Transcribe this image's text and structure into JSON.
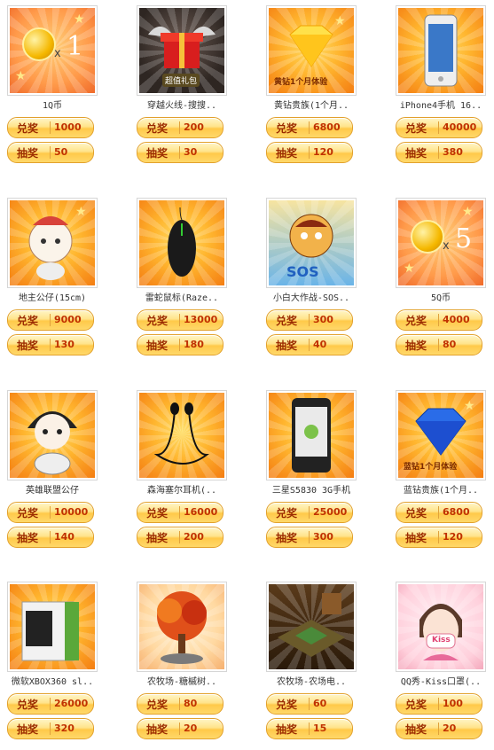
{
  "labels": {
    "exchange": "兑奖",
    "draw": "抽奖"
  },
  "items": [
    {
      "name": "1Q币",
      "exchange": "1000",
      "draw": "50",
      "icon": "qcoin-1-icon",
      "mult": "x",
      "count": "1"
    },
    {
      "name": "穿越火线-搜搜..",
      "exchange": "200",
      "draw": "30",
      "icon": "gift-box-icon",
      "art_text": "超值礼包"
    },
    {
      "name": "黄钻贵族(1个月..",
      "exchange": "6800",
      "draw": "120",
      "icon": "yellow-diamond-icon",
      "art_text": "黄钻1个月体验"
    },
    {
      "name": "iPhone4手机 16..",
      "exchange": "40000",
      "draw": "380",
      "icon": "iphone-icon"
    },
    {
      "name": "地主公仔(15cm)",
      "exchange": "9000",
      "draw": "130",
      "icon": "landlord-doll-icon"
    },
    {
      "name": "雷蛇鼠标(Raze..",
      "exchange": "13000",
      "draw": "180",
      "icon": "mouse-icon"
    },
    {
      "name": "小白大作战-SOS..",
      "exchange": "300",
      "draw": "40",
      "icon": "game-character-icon"
    },
    {
      "name": "5Q币",
      "exchange": "4000",
      "draw": "80",
      "icon": "qcoin-5-icon",
      "mult": "x",
      "count": "5"
    },
    {
      "name": "英雄联盟公仔",
      "exchange": "10000",
      "draw": "140",
      "icon": "hero-doll-icon"
    },
    {
      "name": "森海塞尔耳机(..",
      "exchange": "16000",
      "draw": "200",
      "icon": "earphones-icon"
    },
    {
      "name": "三星S5830 3G手机",
      "exchange": "25000",
      "draw": "300",
      "icon": "android-phone-icon"
    },
    {
      "name": "蓝钻贵族(1个月..",
      "exchange": "6800",
      "draw": "120",
      "icon": "blue-diamond-icon",
      "art_text": "蓝钻1个月体验"
    },
    {
      "name": "微软XBOX360 sl..",
      "exchange": "26000",
      "draw": "320",
      "icon": "xbox-icon"
    },
    {
      "name": "农牧场-糖槭树..",
      "exchange": "80",
      "draw": "20",
      "icon": "maple-tree-icon"
    },
    {
      "name": "农牧场-农场电..",
      "exchange": "60",
      "draw": "15",
      "icon": "farm-scene-icon"
    },
    {
      "name": "QQ秀-Kiss口罩(..",
      "exchange": "100",
      "draw": "20",
      "icon": "avatar-mask-icon",
      "art_text": "Kiss"
    }
  ]
}
